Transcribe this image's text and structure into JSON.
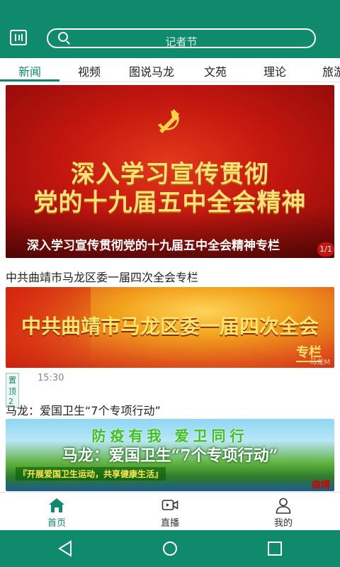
{
  "header": {
    "search_text": "记者节"
  },
  "tabs": [
    {
      "label": "新闻",
      "active": true
    },
    {
      "label": "视频",
      "active": false
    },
    {
      "label": "图说马龙",
      "active": false
    },
    {
      "label": "文苑",
      "active": false
    },
    {
      "label": "理论",
      "active": false
    },
    {
      "label": "旅游",
      "active": false
    }
  ],
  "banner": {
    "line1": "深入学习宣传贯彻",
    "line2": "党的十九届五中全会精神",
    "caption": "深入学习宣传贯彻党的十九届五中全会精神专栏",
    "counter": "1/1"
  },
  "articles": [
    {
      "title": "中共曲靖市马龙区委一届四次全会专栏",
      "image_text": "中共曲靖市马龙区委一届四次全会",
      "image_sub": "专栏",
      "image_watermark": "马龙M",
      "badge": "置顶2",
      "time": "15:30"
    },
    {
      "title": "马龙：爱国卫生“7个专项行动”",
      "image_line1": "防疫有我 爱卫同行",
      "image_line2": "马龙：爱国卫生“7个专项行动”",
      "image_line3": "『开展爱国卫生运动，共享健康生活』",
      "image_watermark": "曲靖"
    }
  ],
  "bottom_nav": [
    {
      "label": "首页",
      "icon": "home-icon",
      "active": true
    },
    {
      "label": "直播",
      "icon": "live-video-icon",
      "active": false
    },
    {
      "label": "我的",
      "icon": "profile-icon",
      "active": false
    }
  ],
  "colors": {
    "brand": "#0f8a6c",
    "banner_red": "#c4170f"
  }
}
